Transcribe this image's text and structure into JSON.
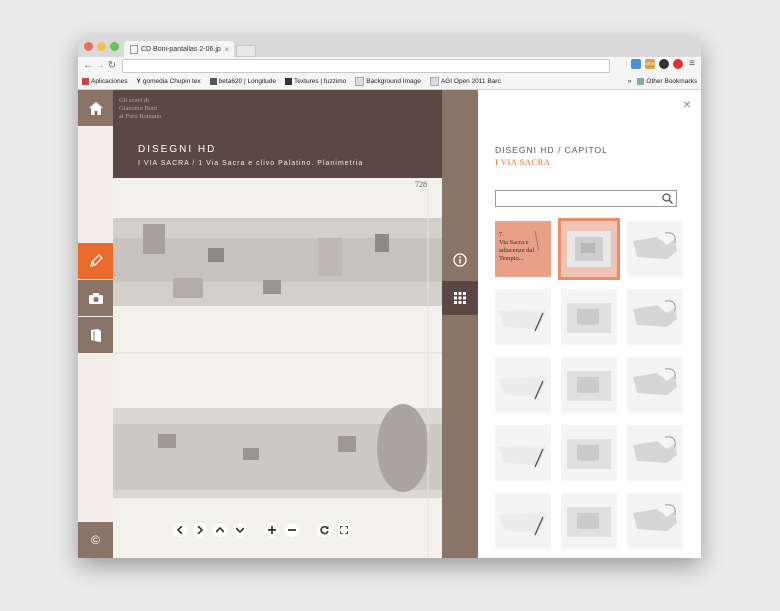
{
  "browser": {
    "tab_title": "CD Boni-pantallas 2-06.jp",
    "tab_close": "×",
    "url": "",
    "bookmarks": [
      {
        "label": "Aplicaciones"
      },
      {
        "label": "gomedia Chupin tex"
      },
      {
        "label": "beta620 | Longitude"
      },
      {
        "label": "Textures | fuzzimo"
      },
      {
        "label": "Background Image"
      },
      {
        "label": "AGI Open 2011 Barc"
      }
    ],
    "bookmarks_overflow": "»",
    "other_bookmarks": "Other Bookmarks",
    "ext_badge": "NEW!"
  },
  "app": {
    "logo_lines": [
      "Gli scavi di",
      "Giacomo Boni",
      "al Foro Romano"
    ],
    "section_title": "DISEGNI HD",
    "breadcrumb": "I VIA SACRA  /  1 Via Sacra e clivo Palatino. Planimetria",
    "drawing_number": "728",
    "left_nav": {
      "home": "home-icon",
      "draw": "pencil-icon",
      "photo": "camera-icon",
      "book": "book-icon",
      "credits": "©"
    }
  },
  "panel": {
    "close": "×",
    "title": "DISEGNI HD / CAPITOL",
    "subtitle": "I VIA SACRA",
    "search_placeholder": "",
    "first_item_text": "7.\nVia Sacra e\nadiacenze dal\nTempio..."
  },
  "colors": {
    "accent": "#e86b2d",
    "brown_dark": "#5b4743",
    "brown_mid": "#8a7367"
  }
}
